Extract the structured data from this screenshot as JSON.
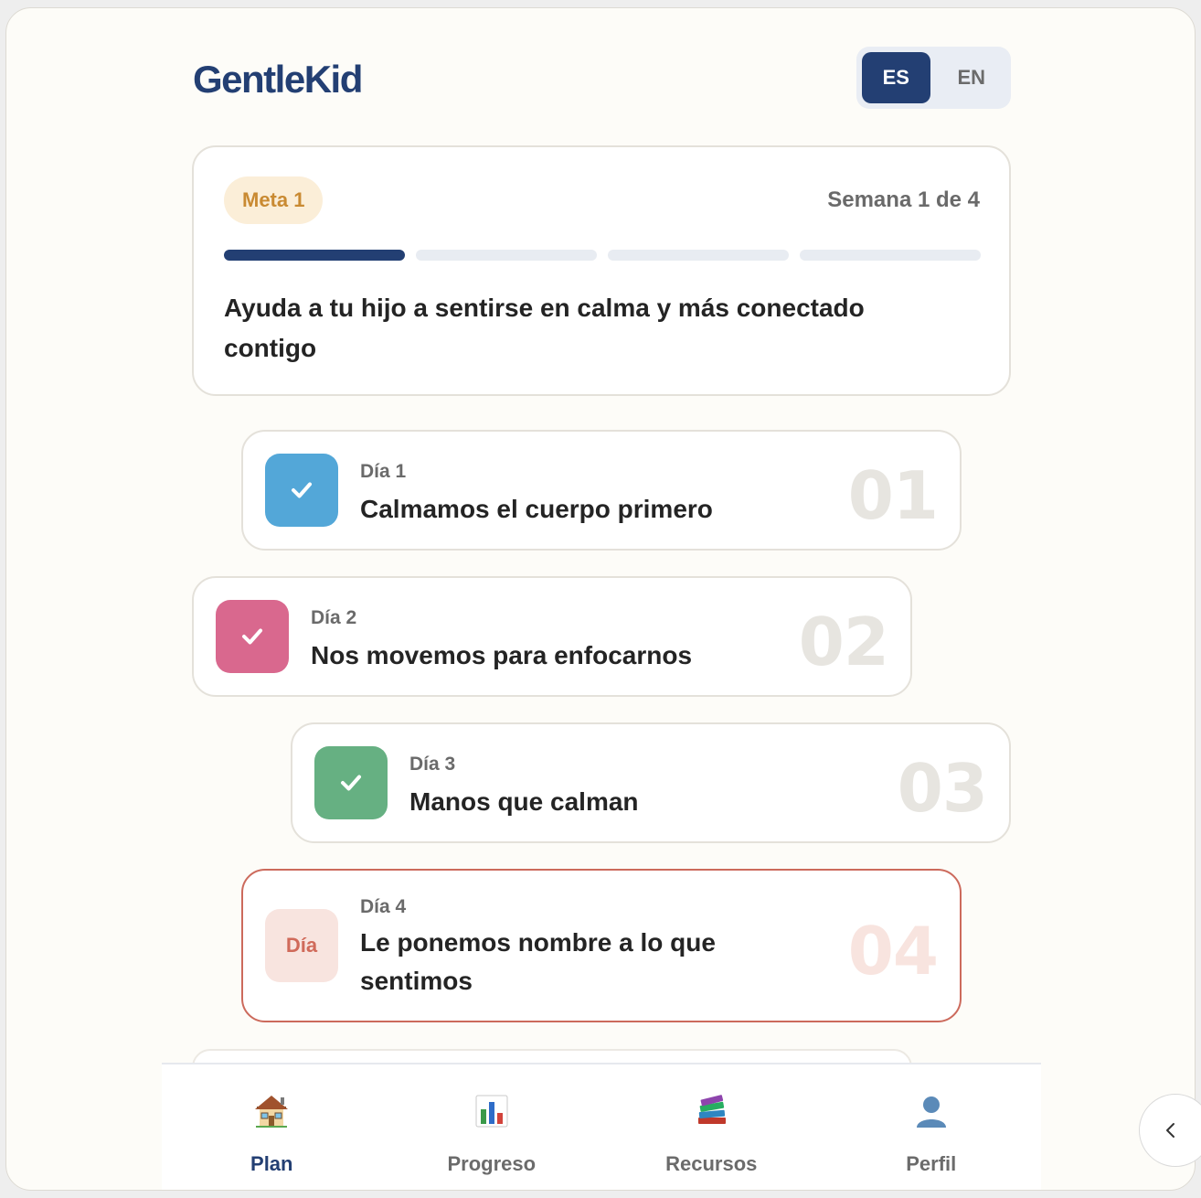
{
  "app": {
    "logo": "GentleKid"
  },
  "language": {
    "options": [
      "ES",
      "EN"
    ],
    "selected": "ES"
  },
  "goal": {
    "badge": "Meta 1",
    "week_label": "Semana 1 de 4",
    "progress": {
      "current_week": 1,
      "total_weeks": 4
    },
    "description": "Ayuda a tu hijo a sentirse en calma y más conectado contigo"
  },
  "days": [
    {
      "label": "Día 1",
      "title": "Calmamos el cuerpo primero",
      "number": "01",
      "status": "completed",
      "color": "#53a7d8",
      "icon": "check-icon"
    },
    {
      "label": "Día 2",
      "title": "Nos movemos para enfocarnos",
      "number": "02",
      "status": "completed",
      "color": "#d9688e",
      "icon": "check-icon"
    },
    {
      "label": "Día 3",
      "title": "Manos que calman",
      "number": "03",
      "status": "completed",
      "color": "#66b082",
      "icon": "check-icon"
    },
    {
      "label": "Día 4",
      "title": "Le ponemos nombre a lo que sentimos",
      "number": "04",
      "status": "current",
      "box_text": "Día",
      "color": "#f8e4df"
    }
  ],
  "nav": [
    {
      "label": "Plan",
      "icon": "house-icon",
      "active": true
    },
    {
      "label": "Progreso",
      "icon": "bar-chart-icon",
      "active": false
    },
    {
      "label": "Recursos",
      "icon": "books-icon",
      "active": false
    },
    {
      "label": "Perfil",
      "icon": "person-icon",
      "active": false
    }
  ],
  "colors": {
    "primary": "#233f73",
    "accent": "#cc6a5c",
    "badge_bg": "#fbeed8",
    "badge_text": "#c98a32"
  }
}
